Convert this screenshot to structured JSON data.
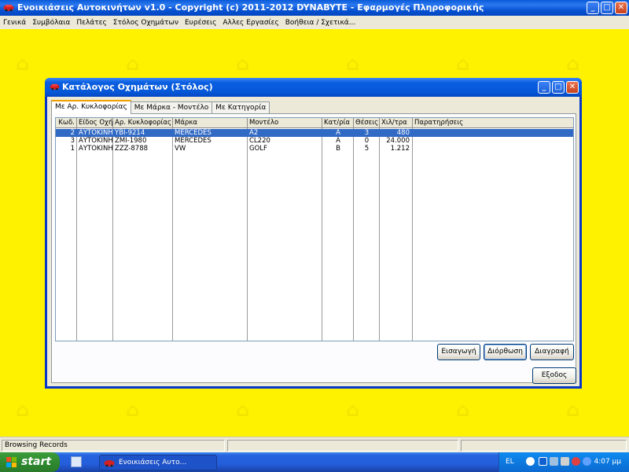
{
  "app": {
    "title": "Ενοικιάσεις Αυτοκινήτων  v1.0  -  Copyright (c)  2011-2012  DYNABYTE - Εφαρμογές Πληροφορικής",
    "min": "_",
    "max": "□",
    "close": "✕"
  },
  "menu": [
    "Γενικά",
    "Συμβόλαια",
    "Πελάτες",
    "Στόλος Οχημάτων",
    "Ευρέσεις",
    "Αλλες Εργασίες",
    "Βοήθεια / Σχετικά..."
  ],
  "window": {
    "title": "Κατάλογος Οχημάτων (Στόλος)",
    "tabs": [
      "Με Αρ. Κυκλοφορίας",
      "Με Μάρκα - Μοντέλο",
      "Με Κατηγορία"
    ],
    "active_tab": 0,
    "columns": [
      "Κωδ.",
      "Είδος Οχήμ",
      "Αρ. Κυκλοφορίας",
      "Μάρκα",
      "Μοντέλο",
      "Κατ/ρία",
      "Θέσεις",
      "Χιλ/τρα",
      "Παρατηρήσεις"
    ],
    "rows": [
      {
        "code": "2",
        "kind": "ΑΥΤΟΚΙΝΗΤ",
        "plate": "YBI-9214",
        "brand": "MERCEDES",
        "model": "A2",
        "category": "A",
        "seats": "3",
        "km": "480",
        "notes": "",
        "selected": true
      },
      {
        "code": "3",
        "kind": "ΑΥΤΟΚΙΝΗΤ",
        "plate": "ZMI-1980",
        "brand": "MERCEDES",
        "model": "CL220",
        "category": "A",
        "seats": "0",
        "km": "24.000",
        "notes": "",
        "selected": false
      },
      {
        "code": "1",
        "kind": "ΑΥΤΟΚΙΝΗΤ",
        "plate": "ZZZ-8788",
        "brand": "VW",
        "model": "GOLF",
        "category": "B",
        "seats": "5",
        "km": "1.212",
        "notes": "",
        "selected": false
      }
    ],
    "buttons": {
      "insert": "Εισαγωγή",
      "edit": "Διόρθωση",
      "delete": "Διαγραφή",
      "exit": "Εξοδος"
    }
  },
  "status": {
    "text": "Browsing Records"
  },
  "taskbar": {
    "start": "start",
    "task": "Ενοικιάσεις Αυτο...",
    "lang": "EL",
    "clock": "4:07 μμ"
  }
}
